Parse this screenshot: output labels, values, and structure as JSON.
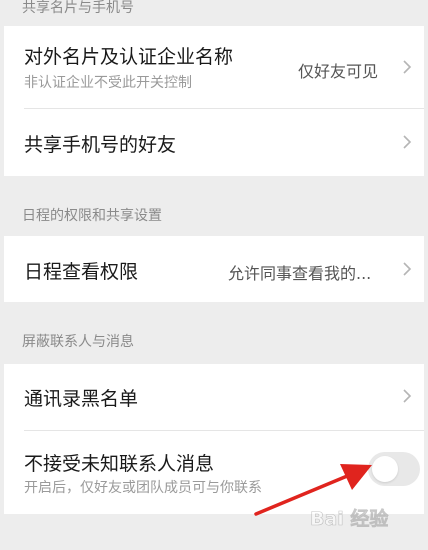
{
  "sections": {
    "share_card_phone": {
      "header": "共享名片与手机号"
    },
    "schedule": {
      "header": "日程的权限和共享设置"
    },
    "block": {
      "header": "屏蔽联系人与消息"
    }
  },
  "rows": {
    "external_card": {
      "title": "对外名片及认证企业名称",
      "subtitle": "非认证企业不受此开关控制",
      "value": "仅好友可见"
    },
    "share_phone": {
      "title": "共享手机号的好友"
    },
    "schedule_view": {
      "title": "日程查看权限",
      "value": "允许同事查看我的..."
    },
    "blacklist": {
      "title": "通讯录黑名单"
    },
    "block_unknown": {
      "title": "不接受未知联系人消息",
      "subtitle": "开启后，仅好友或团队成员可与你联系",
      "toggle_on": false
    }
  },
  "icons": {
    "chevron": "chevron-right-icon",
    "annotation": "red-arrow-icon",
    "watermark": "baidu-jingyan-logo"
  },
  "watermark_text": "Bai 经验",
  "colors": {
    "background": "#ededed",
    "card": "#ffffff",
    "arrow": "#e0241e",
    "toggle_off": "#e8e8e8"
  }
}
